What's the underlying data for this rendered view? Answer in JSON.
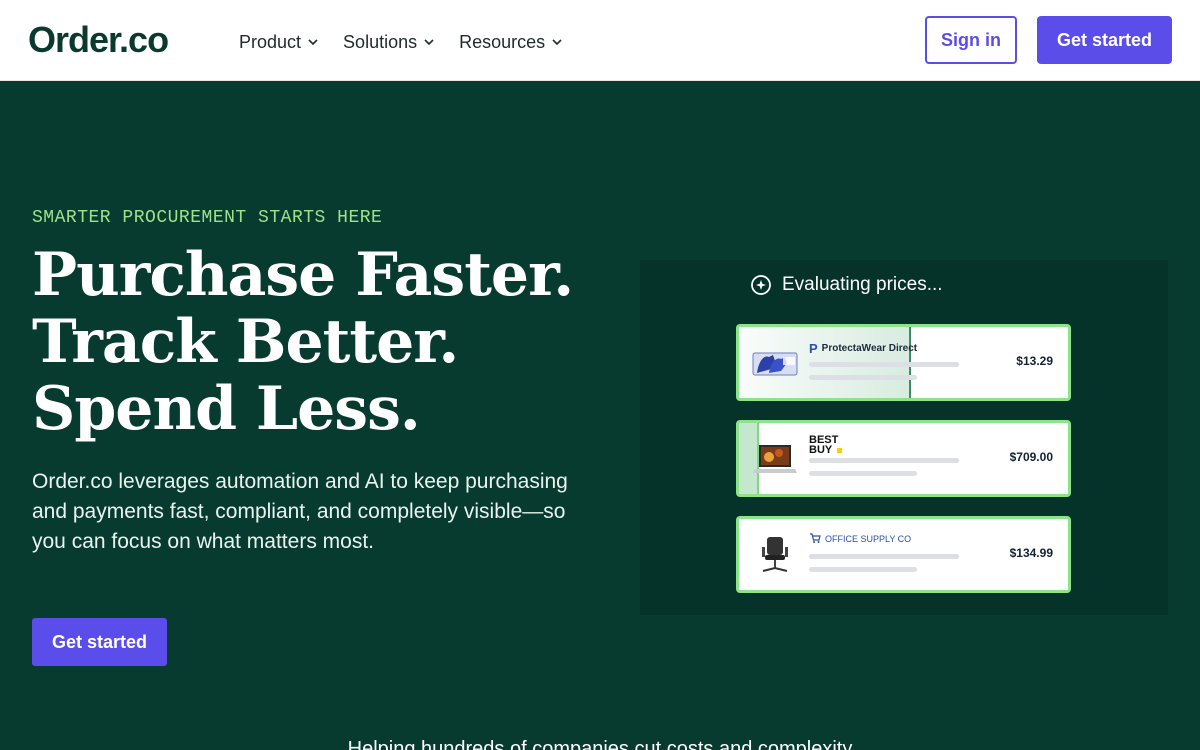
{
  "header": {
    "logo": "Order.co",
    "nav": [
      {
        "label": "Product"
      },
      {
        "label": "Solutions"
      },
      {
        "label": "Resources"
      }
    ],
    "sign_in": "Sign in",
    "get_started": "Get started"
  },
  "hero": {
    "eyebrow": "SMARTER PROCUREMENT STARTS HERE",
    "headline": [
      "Purchase Faster.",
      "Track Better.",
      "Spend Less."
    ],
    "description": "Order.co leverages automation and AI to keep purchasing and payments fast, compliant, and completely visible—so you can focus on what matters most.",
    "cta": "Get started"
  },
  "panel": {
    "status": "Evaluating prices...",
    "cards": [
      {
        "vendor": "ProtectaWear Direct",
        "price": "$13.29",
        "icon": "gloves-box-icon",
        "vendor_icon": "protectawear-logo"
      },
      {
        "vendor": "BEST BUY",
        "price": "$709.00",
        "icon": "laptop-icon",
        "vendor_icon": "bestbuy-logo"
      },
      {
        "vendor": "OFFICE SUPPLY CO",
        "price": "$134.99",
        "icon": "office-chair-icon",
        "vendor_icon": "cart-icon"
      }
    ]
  },
  "footer_teaser": "Helping hundreds of companies cut costs and complexity",
  "colors": {
    "brand_green": "#073b2f",
    "accent_purple": "#5b4dea",
    "eyebrow_green": "#9fe28a"
  }
}
